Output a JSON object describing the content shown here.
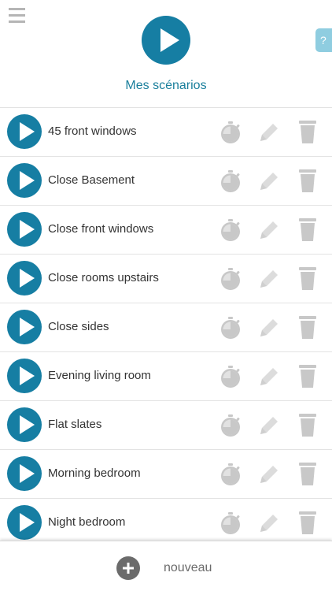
{
  "header": {
    "title": "Mes scénarios",
    "help_label": "?"
  },
  "scenarios": [
    {
      "label": "45 front windows"
    },
    {
      "label": "Close Basement"
    },
    {
      "label": "Close front windows"
    },
    {
      "label": "Close rooms upstairs"
    },
    {
      "label": "Close sides"
    },
    {
      "label": "Evening living room"
    },
    {
      "label": "Flat slates"
    },
    {
      "label": "Morning bedroom"
    },
    {
      "label": "Night bedroom"
    }
  ],
  "footer": {
    "add_label": "nouveau"
  },
  "icons": {
    "menu": "menu-icon",
    "play": "play-icon",
    "timer": "timer-icon",
    "edit": "pencil-icon",
    "delete": "trash-icon",
    "add": "plus-icon"
  },
  "colors": {
    "accent": "#167ea3",
    "title": "#1a7f9c",
    "icon_gray": "#c8c8c8",
    "help_bg": "#8fcde0"
  }
}
